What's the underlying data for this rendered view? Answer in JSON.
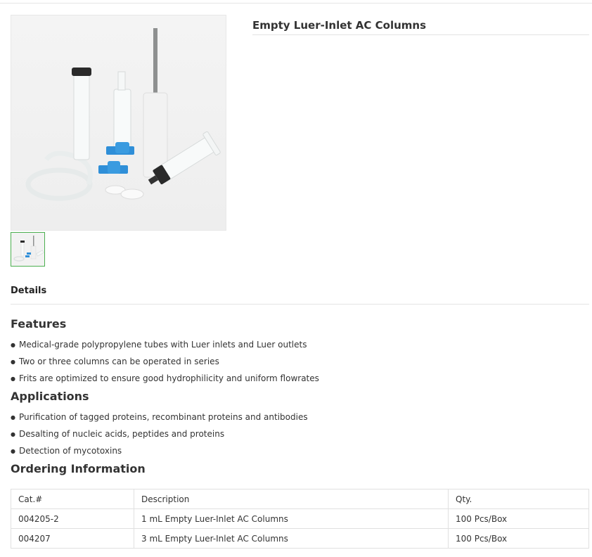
{
  "product": {
    "title": "Empty Luer-Inlet AC Columns",
    "image_icon": "product-photo-columns",
    "thumbnail_icon": "product-thumbnail"
  },
  "details": {
    "label": "Details"
  },
  "features": {
    "heading": "Features",
    "items": [
      "Medical-grade polypropylene tubes with Luer inlets and Luer outlets",
      "Two or three columns can be operated in series",
      "Frits are optimized to ensure good hydrophilicity and uniform flowrates"
    ]
  },
  "applications": {
    "heading": "Applications",
    "items": [
      "Purification of tagged proteins, recombinant proteins and antibodies",
      "Desalting of nucleic acids, peptides and proteins",
      "Detection of mycotoxins"
    ]
  },
  "ordering": {
    "heading": "Ordering Information",
    "columns": [
      "Cat.#",
      "Description",
      "Qty."
    ],
    "rows": [
      [
        "004205-2",
        "1 mL Empty Luer-Inlet AC Columns",
        "100 Pcs/Box"
      ],
      [
        "004207",
        "3 mL Empty Luer-Inlet AC Columns",
        "100 Pcs/Box"
      ]
    ]
  },
  "colors": {
    "accent_blue": "#2f8fd8",
    "thumb_border": "#4caf50"
  }
}
